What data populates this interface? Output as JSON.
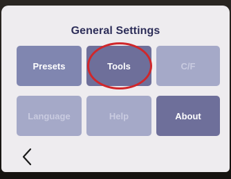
{
  "screen": {
    "title": "General Settings"
  },
  "tiles": [
    {
      "label": "Presets",
      "state": "enabled"
    },
    {
      "label": "Tools",
      "state": "enabled",
      "highlighted": true
    },
    {
      "label": "C/F",
      "state": "disabled"
    },
    {
      "label": "Language",
      "state": "disabled"
    },
    {
      "label": "Help",
      "state": "disabled"
    },
    {
      "label": "About",
      "state": "enabled"
    }
  ],
  "navigation": {
    "back_icon": "chevron-left-icon"
  },
  "colors": {
    "title": "#2d2e59",
    "tile_enabled": "#8086b0",
    "tile_disabled": "#a5a9c8",
    "annotation_ring": "#d0272b"
  }
}
